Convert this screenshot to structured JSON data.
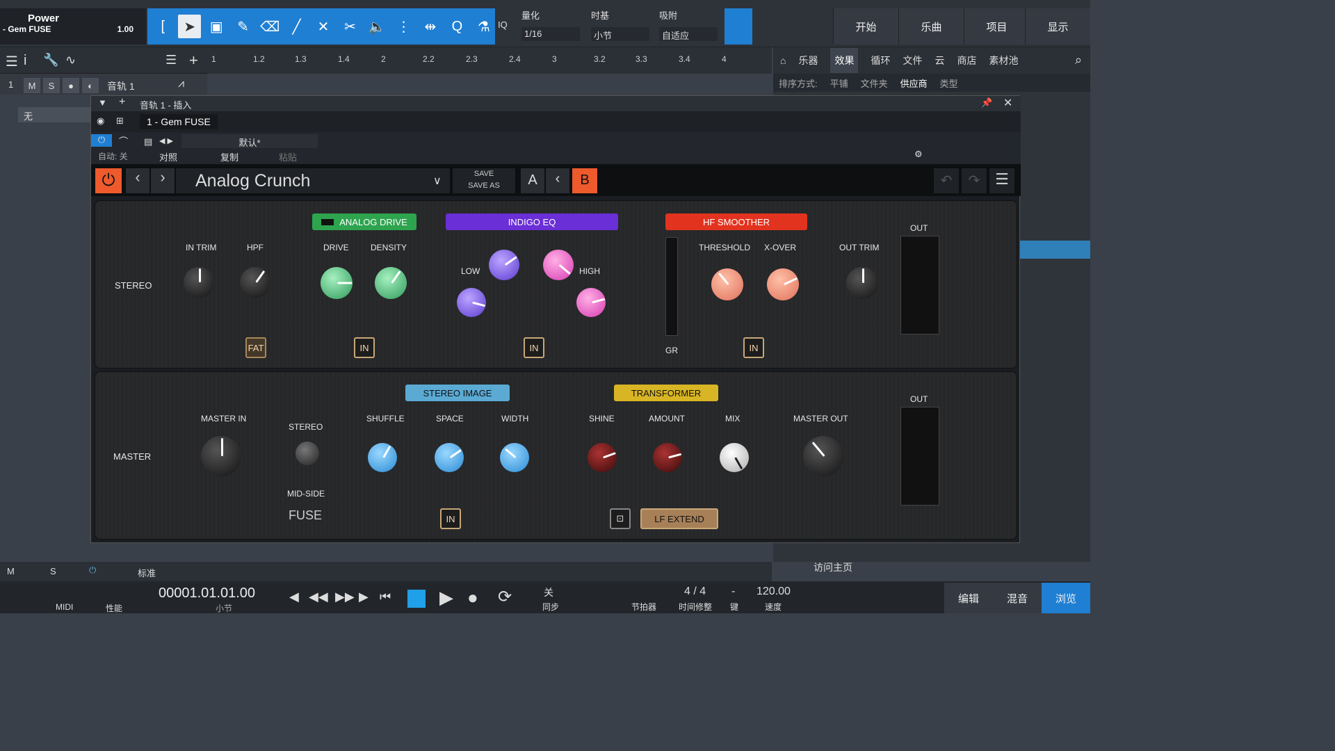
{
  "toolbar": {
    "title": "Power",
    "sub": "- Gem FUSE",
    "zoom": "1.00",
    "iq": "IQ",
    "quantize_label": "量化",
    "quantize_value": "1/16",
    "timebase_label": "时基",
    "timebase_value": "小节",
    "snap_label": "吸附",
    "snap_value": "自适应",
    "nav": [
      "开始",
      "乐曲",
      "项目",
      "显示"
    ]
  },
  "ruler": [
    "1",
    "1.2",
    "1.3",
    "1.4",
    "2",
    "2.2",
    "2.3",
    "2.4",
    "3",
    "3.2",
    "3.3",
    "3.4",
    "4"
  ],
  "browser": {
    "tabs": [
      "乐器",
      "效果",
      "循环",
      "文件",
      "云",
      "商店",
      "素材池"
    ],
    "active_tab": "效果",
    "sort_label": "排序方式:",
    "sort_options": [
      "平铺",
      "文件夹",
      "供应商",
      "类型"
    ],
    "active_sort": "供应商",
    "home_link": "访问主页"
  },
  "track": {
    "number": "1",
    "m": "M",
    "s": "S",
    "name": "音轨 1",
    "none": "无"
  },
  "plugin_window": {
    "title": "音轨 1 - 插入",
    "device": "1 - Gem FUSE",
    "auto_label": "自动: 关",
    "preset_default": "默认*",
    "compare": "对照",
    "copy": "复制",
    "paste": "粘贴"
  },
  "plugin_bar": {
    "preset_name": "Analog Crunch",
    "save": "SAVE",
    "save_as": "SAVE AS",
    "a": "A",
    "b": "B"
  },
  "top_panel": {
    "row_label": "STEREO",
    "sections": {
      "analog_drive": "ANALOG DRIVE",
      "indigo_eq": "INDIGO EQ",
      "hf_smoother": "HF SMOOTHER"
    },
    "knob_labels": {
      "in_trim": "IN TRIM",
      "hpf": "HPF",
      "drive": "DRIVE",
      "density": "DENSITY",
      "low": "LOW",
      "high": "HIGH",
      "threshold": "THRESHOLD",
      "xover": "X-OVER",
      "out_trim": "OUT TRIM"
    },
    "fat": "FAT",
    "in": "IN",
    "gr": "GR",
    "out": "OUT"
  },
  "bottom_panel": {
    "row_label": "MASTER",
    "sections": {
      "stereo_image": "STEREO IMAGE",
      "transformer": "TRANSFORMER"
    },
    "knob_labels": {
      "master_in": "MASTER IN",
      "stereo": "STEREO",
      "mid_side": "MID-SIDE",
      "shuffle": "SHUFFLE",
      "space": "SPACE",
      "width": "WIDTH",
      "shine": "SHINE",
      "amount": "AMOUNT",
      "mix": "MIX",
      "master_out": "MASTER OUT"
    },
    "fuse": "FUSE",
    "lf_extend": "LF EXTEND",
    "in": "IN",
    "out": "OUT"
  },
  "transport": {
    "time": "00001.01.01.00",
    "time_unit": "小节",
    "midi": "MIDI",
    "perf": "性能",
    "standard": "标准",
    "sync_top": "关",
    "sync": "同步",
    "metronome": "节拍器",
    "signature": "4 / 4",
    "sig_label": "时间修整",
    "key_top": "-",
    "key": "键",
    "tempo": "120.00",
    "tempo_label": "速度",
    "m": "M",
    "s": "S"
  },
  "bottom_nav": [
    "编辑",
    "混音",
    "浏览"
  ],
  "colors": {
    "accent_blue": "#1f7fd3",
    "drive_green": "#2ea44f",
    "eq_purple": "#6a2fd6",
    "hf_red": "#e2331f",
    "stereo_image": "#5aaad4",
    "transformer": "#d8b524",
    "b_orange": "#ee5a2c"
  }
}
